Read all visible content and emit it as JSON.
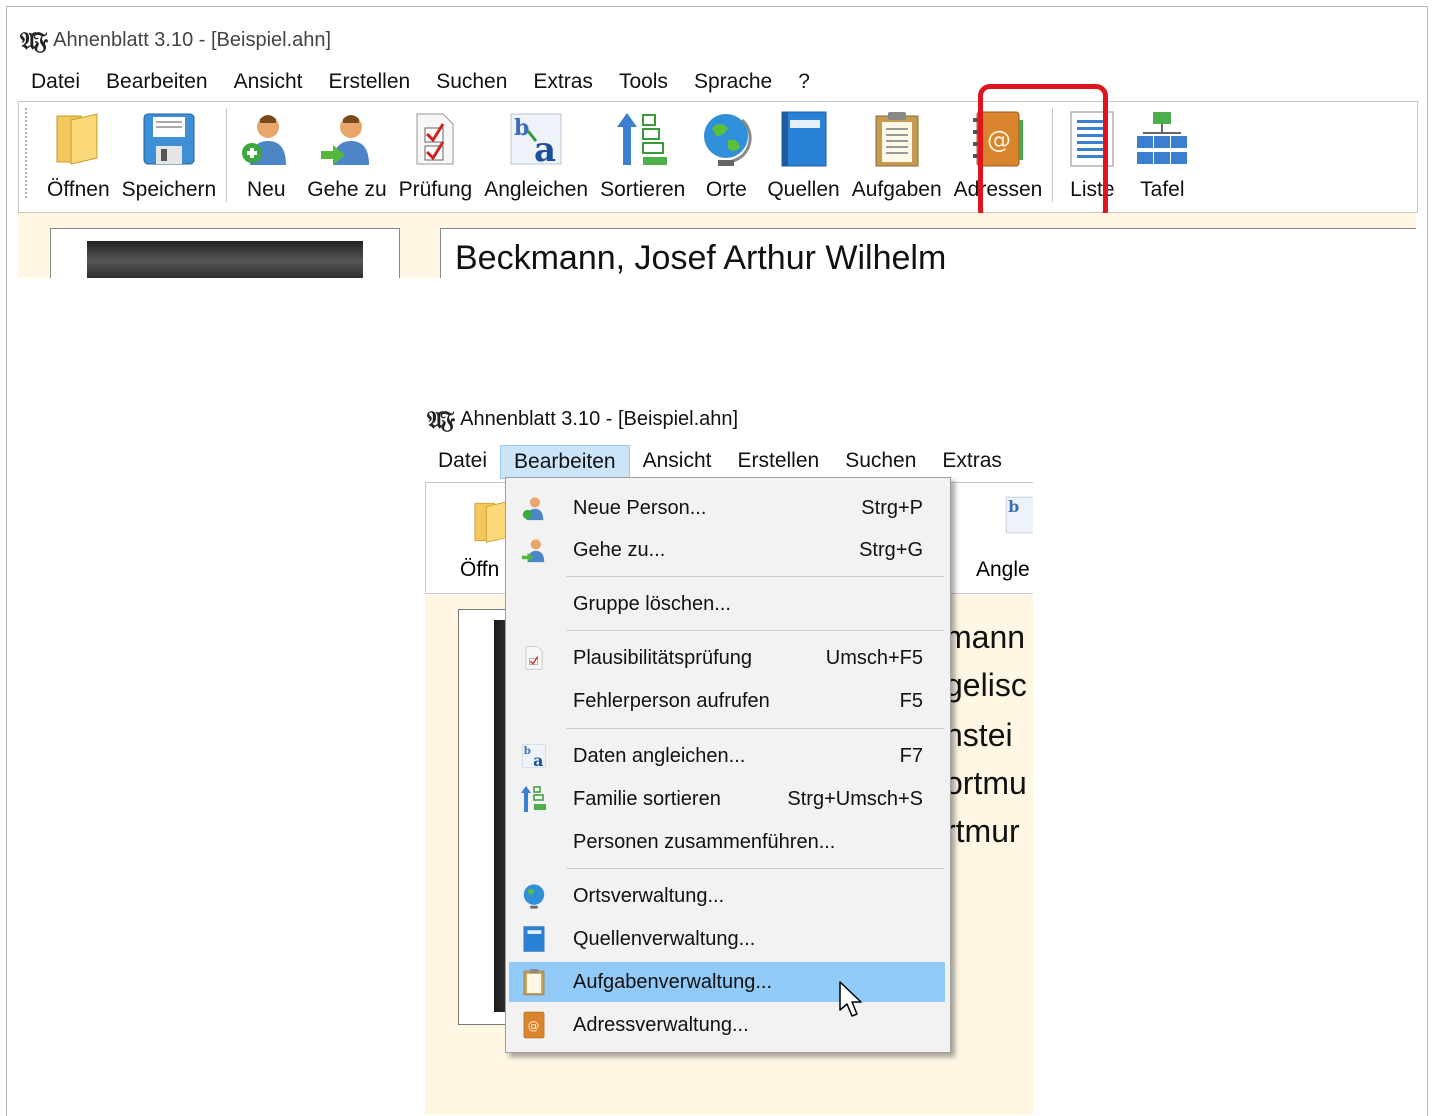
{
  "app_title": "Ahnenblatt 3.10 - [Beispiel.ahn]",
  "logo_text": "𝔄𝔉",
  "menu": [
    "Datei",
    "Bearbeiten",
    "Ansicht",
    "Erstellen",
    "Suchen",
    "Extras",
    "Tools",
    "Sprache",
    "?"
  ],
  "toolbar": [
    {
      "label": "Öffnen",
      "icon": "folder-icon"
    },
    {
      "label": "Speichern",
      "icon": "save-icon"
    },
    {
      "label": "Neu",
      "icon": "new-person-icon"
    },
    {
      "label": "Gehe zu",
      "icon": "goto-person-icon"
    },
    {
      "label": "Prüfung",
      "icon": "check-icon"
    },
    {
      "label": "Angleichen",
      "icon": "match-icon"
    },
    {
      "label": "Sortieren",
      "icon": "sort-icon"
    },
    {
      "label": "Orte",
      "icon": "globe-icon"
    },
    {
      "label": "Quellen",
      "icon": "book-icon"
    },
    {
      "label": "Aufgaben",
      "icon": "clipboard-icon"
    },
    {
      "label": "Adressen",
      "icon": "address-book-icon"
    },
    {
      "label": "Liste",
      "icon": "list-icon"
    },
    {
      "label": "Tafel",
      "icon": "tree-icon"
    }
  ],
  "person_name": "Beckmann, Josef Arthur Wilhelm",
  "second": {
    "menu": [
      "Datei",
      "Bearbeiten",
      "Ansicht",
      "Erstellen",
      "Suchen",
      "Extras"
    ],
    "toolbar_left": "Öffn",
    "toolbar_right": "Angle",
    "right_text": [
      "mann",
      "gelisc",
      "nstei",
      "ortmu",
      "rtmur"
    ]
  },
  "dropdown": [
    {
      "label": "Neue Person...",
      "shortcut": "Strg+P",
      "icon": "new-person-icon"
    },
    {
      "label": "Gehe zu...",
      "shortcut": "Strg+G",
      "icon": "goto-person-icon"
    },
    {
      "label": "Gruppe löschen...",
      "shortcut": "",
      "icon": ""
    },
    {
      "label": "Plausibilitätsprüfung",
      "shortcut": "Umsch+F5",
      "icon": "check-icon"
    },
    {
      "label": "Fehlerperson aufrufen",
      "shortcut": "F5",
      "icon": ""
    },
    {
      "label": "Daten angleichen...",
      "shortcut": "F7",
      "icon": "match-icon"
    },
    {
      "label": "Familie sortieren",
      "shortcut": "Strg+Umsch+S",
      "icon": "sort-icon"
    },
    {
      "label": "Personen zusammenführen...",
      "shortcut": "",
      "icon": ""
    },
    {
      "label": "Ortsverwaltung...",
      "shortcut": "",
      "icon": "globe-icon"
    },
    {
      "label": "Quellenverwaltung...",
      "shortcut": "",
      "icon": "book-icon"
    },
    {
      "label": "Aufgabenverwaltung...",
      "shortcut": "",
      "icon": "clipboard-icon"
    },
    {
      "label": "Adressverwaltung...",
      "shortcut": "",
      "icon": "address-book-icon"
    }
  ],
  "colors": {
    "highlight_border": "#e0141e",
    "menu_hover": "#91c9f7",
    "content_bg": "#fff7e4"
  }
}
